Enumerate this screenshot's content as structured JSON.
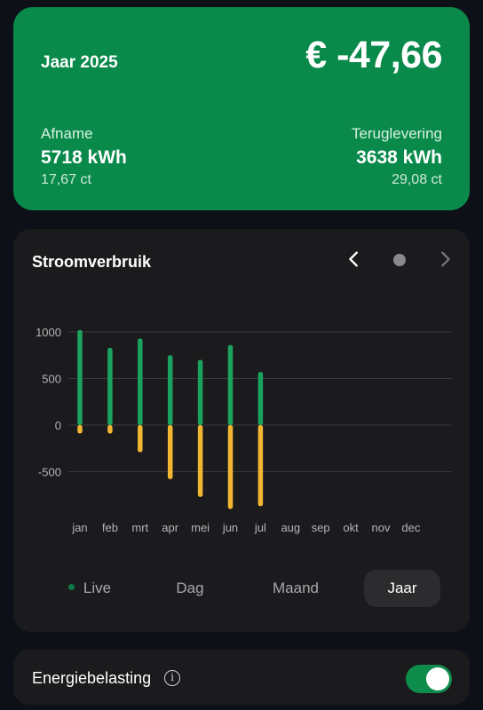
{
  "summary": {
    "period": "Jaar 2025",
    "total": "€ -47,66",
    "left": {
      "label": "Afname",
      "kwh": "5718 kWh",
      "price": "17,67 ct"
    },
    "right": {
      "label": "Teruglevering",
      "kwh": "3638 kWh",
      "price": "29,08 ct"
    }
  },
  "chart_card": {
    "title": "Stroomverbruik",
    "tabs": [
      {
        "label": "Live"
      },
      {
        "label": "Dag"
      },
      {
        "label": "Maand"
      },
      {
        "label": "Jaar"
      }
    ]
  },
  "tax": {
    "label": "Energiebelasting",
    "info_glyph": "i",
    "enabled": true
  },
  "colors": {
    "consumption": "#1aa35e",
    "return": "#f2b632",
    "card": "#1b1b1d",
    "accent": "#098a4b"
  },
  "chart_data": {
    "type": "bar",
    "categories": [
      "jan",
      "feb",
      "mrt",
      "apr",
      "mei",
      "jun",
      "jul",
      "aug",
      "sep",
      "okt",
      "nov",
      "dec"
    ],
    "series": [
      {
        "values": [
          1020,
          830,
          930,
          750,
          700,
          860,
          570,
          null,
          null,
          null,
          null,
          null
        ]
      },
      {
        "values": [
          -90,
          -90,
          -290,
          -580,
          -770,
          -900,
          -870,
          null,
          null,
          null,
          null,
          null
        ]
      }
    ],
    "yticks": [
      1000,
      500,
      0,
      -500
    ],
    "ylim": [
      -1000,
      1100
    ],
    "grid": true
  }
}
